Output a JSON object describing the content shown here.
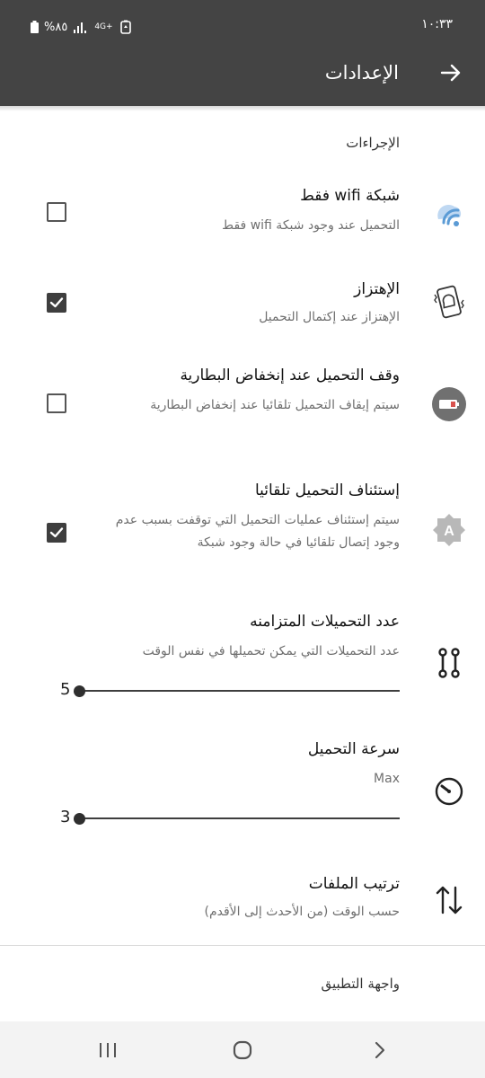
{
  "status_bar": {
    "time": "١٠:٣٣",
    "battery": "%٨٥",
    "network": "4G+"
  },
  "app_bar": {
    "title": "الإعدادات",
    "back_icon": "arrow-right-icon"
  },
  "sections": {
    "actions": "الإجراءات",
    "app_interface": "واجهة التطبيق"
  },
  "preferences": {
    "wifi_only": {
      "title": "شبكة wifi فقط",
      "summary": "التحميل عند وجود شبكة wifi فقط",
      "checked": false,
      "icon": "wifi-icon"
    },
    "vibrate": {
      "title": "الإهتزاز",
      "summary": "الإهتزاز عند إكتمال التحميل",
      "checked": true,
      "icon": "phone-vibrate-icon"
    },
    "low_battery": {
      "title": "وقف التحميل عند إنخفاض البطارية",
      "summary": "سيتم إيقاف التحميل تلقائيا عند إنخفاض البطارية",
      "checked": false,
      "icon": "low-battery-icon"
    },
    "auto_resume": {
      "title": "إستئناف التحميل تلقائيا",
      "summary": "سيتم إستئناف عمليات التحميل التي توقفت بسبب عدم وجود إتصال تلقائيا في حالة وجود شبكة",
      "checked": true,
      "icon": "auto-brightness-icon"
    },
    "concurrent": {
      "title": "عدد التحميلات المتزامنه",
      "summary": "عدد التحميلات التي يمكن تحميلها في نفس الوقت",
      "value": "5",
      "icon": "concurrent-icon"
    },
    "speed": {
      "title": "سرعة التحميل",
      "summary": "Max",
      "value": "3",
      "icon": "speedometer-icon"
    },
    "sort": {
      "title": "ترتيب الملفات",
      "summary": "حسب الوقت (من الأحدث إلى الأقدم)",
      "icon": "sort-icon"
    }
  },
  "nav_bar": {
    "recents_icon": "recents-icon",
    "home_icon": "home-icon",
    "back_icon": "chevron-back-icon"
  },
  "colors": {
    "app_bar": "#444444",
    "accent": "#3e3e3e",
    "wifi_icon": "#5b9bd5"
  }
}
